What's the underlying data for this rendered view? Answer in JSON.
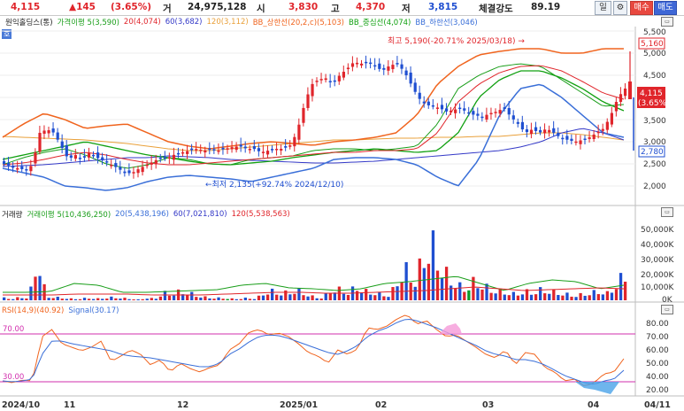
{
  "header": {
    "price": "4,115",
    "change": "▲145",
    "change_pct": "(3.65%)",
    "volume_label": "거",
    "volume": "24,975,128",
    "open_label": "시",
    "open": "3,830",
    "high_label": "고",
    "high": "4,370",
    "low_label": "저",
    "low": "3,815",
    "strength_label": "체결강도",
    "strength": "89.19",
    "period_button": "일",
    "buy_button": "매수",
    "sell_button": "매도"
  },
  "price_pane": {
    "badge": "호",
    "legend": {
      "stock_name": "원익홀딩스(통)",
      "ma_label": "가격이평",
      "ma5": "5(3,590)",
      "ma20": "20(4,074)",
      "ma60": "60(3,682)",
      "ma120": "120(3,112)",
      "bb_upper": "BB_상한선(20,2,c)(5,103)",
      "bb_mid": "BB_중심선(4,074)",
      "bb_lower": "BB_하한선(3,046)"
    },
    "y_ticks": [
      "5,500",
      "5,000",
      "4,500",
      "4,000",
      "3,500",
      "3,000",
      "2,500",
      "2,000"
    ],
    "high_note": "최고 5,190(-20.71% 2025/03/18) →",
    "low_note": "←최저 2,135(+92.74% 2024/12/10)",
    "price_tag": "4,115",
    "price_tag_pct": "(3.65%)",
    "tag_upper": "5,160",
    "tag_lower": "2,780"
  },
  "volume_pane": {
    "legend": {
      "title": "거래량",
      "ma_label": "거래이평",
      "ma5": "5(10,436,250)",
      "ma20": "20(5,438,196)",
      "ma60": "60(7,021,810)",
      "ma120": "120(5,538,563)"
    },
    "y_ticks": [
      "50,000K",
      "40,000K",
      "30,000K",
      "20,000K",
      "10,000K",
      "0K"
    ]
  },
  "rsi_pane": {
    "legend": {
      "rsi": "RSI(14,9)(40.92)",
      "signal": "Signal(30.17)"
    },
    "y_ticks": [
      "80.00",
      "70.00",
      "60.00",
      "50.00",
      "40.00",
      "30.00",
      "20.00"
    ],
    "level_high_label": "70.00",
    "level_low_label": "30.00"
  },
  "x_axis": {
    "labels": [
      "2024/10",
      "11",
      "12",
      "2025/01",
      "02",
      "03",
      "04",
      "04/11"
    ]
  },
  "colors": {
    "up": "#e0252b",
    "down": "#1f4fd1",
    "green": "#0c9a2a",
    "ma5": "#1a9e1a",
    "ma20": "#e0252b",
    "ma60": "#3338c7",
    "ma120": "#e9a03a",
    "bb_upper": "#f0641e",
    "bb_mid": "#10a010",
    "bb_lower": "#3a6fd8",
    "rsi": "#f0641e",
    "signal": "#3a6fd8",
    "level": "#d22fae"
  }
}
